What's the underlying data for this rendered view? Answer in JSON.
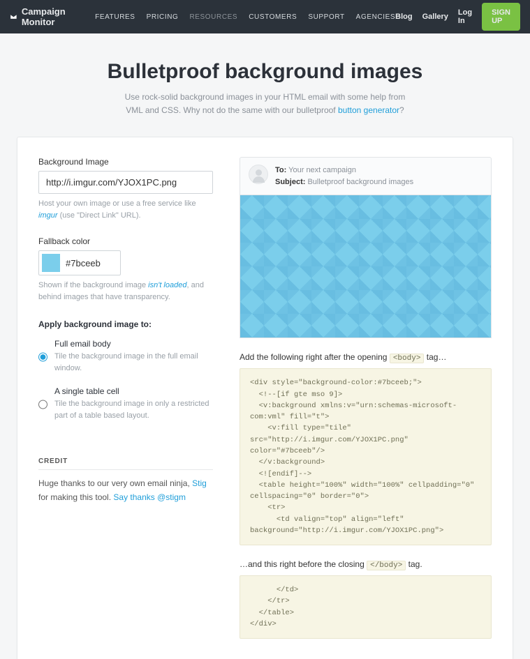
{
  "brand": "Campaign Monitor",
  "nav": {
    "items": [
      "FEATURES",
      "PRICING",
      "RESOURCES",
      "CUSTOMERS",
      "SUPPORT",
      "AGENCIES"
    ],
    "active": 2
  },
  "rightnav": {
    "blog": "Blog",
    "gallery": "Gallery",
    "login": "Log In",
    "signup": "SIGN UP"
  },
  "hero": {
    "title": "Bulletproof background images",
    "line1": "Use rock-solid background images in your HTML email with some help from",
    "line2a": "VML and CSS. Why not do the same with our bulletproof ",
    "link": "button generator",
    "line2b": "?"
  },
  "form": {
    "bg_label": "Background Image",
    "bg_value": "http://i.imgur.com/YJOX1PC.png",
    "bg_help_a": "Host your own image or use a free service like ",
    "bg_help_link": "imgur",
    "bg_help_b": " (use \"Direct Link\" URL).",
    "fb_label": "Fallback color",
    "fb_value": "#7bceeb",
    "fb_help_a": "Shown if the background image ",
    "fb_help_link": "isn't loaded",
    "fb_help_b": ", and behind images that have transparency.",
    "apply_title": "Apply background image to:",
    "opt1_label": "Full email body",
    "opt1_desc": "Tile the background image in the full email window.",
    "opt2_label": "A single table cell",
    "opt2_desc": "Tile the background image in only a restricted part of a table based layout."
  },
  "preview": {
    "to_label": "To:",
    "to_value": "Your next campaign",
    "subject_label": "Subject:",
    "subject_value": "Bulletproof background images"
  },
  "code": {
    "intro1a": "Add the following right after the opening ",
    "intro1tag": "<body>",
    "intro1b": " tag…",
    "block1": "<div style=\"background-color:#7bceeb;\">\n  <!--[if gte mso 9]>\n  <v:background xmlns:v=\"urn:schemas-microsoft-com:vml\" fill=\"t\">\n    <v:fill type=\"tile\" src=\"http://i.imgur.com/YJOX1PC.png\" color=\"#7bceeb\"/>\n  </v:background>\n  <![endif]-->\n  <table height=\"100%\" width=\"100%\" cellpadding=\"0\" cellspacing=\"0\" border=\"0\">\n    <tr>\n      <td valign=\"top\" align=\"left\" background=\"http://i.imgur.com/YJOX1PC.png\">",
    "intro2a": "…and this right before the closing ",
    "intro2tag": "</body>",
    "intro2b": " tag.",
    "block2": "      </td>\n    </tr>\n  </table>\n</div>"
  },
  "credit": {
    "heading": "CREDIT",
    "text_a": "Huge thanks to our very own email ninja, ",
    "link1": "Stig",
    "text_b": " for making this tool. ",
    "link2": "Say thanks @stigm"
  }
}
